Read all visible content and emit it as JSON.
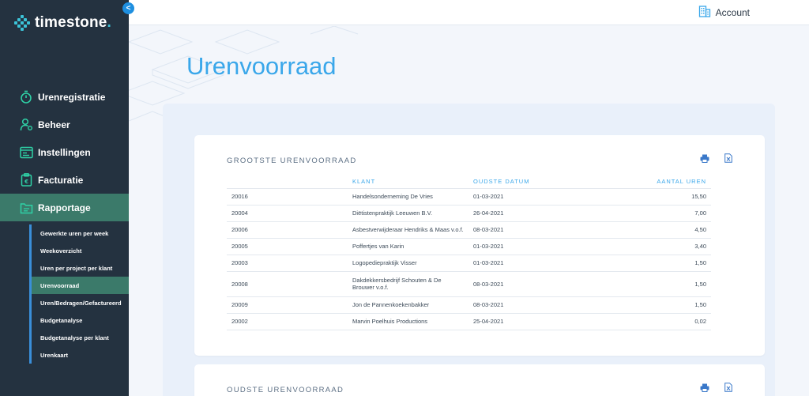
{
  "app": {
    "logo_text": "timestone",
    "logo_dot": ".",
    "collapse_label": "<"
  },
  "topbar": {
    "account_label": "Account"
  },
  "nav": {
    "items": [
      {
        "label": "Urenregistratie",
        "icon": "stopwatch-icon"
      },
      {
        "label": "Beheer",
        "icon": "user-gear-icon"
      },
      {
        "label": "Instellingen",
        "icon": "settings-window-icon"
      },
      {
        "label": "Facturatie",
        "icon": "invoice-clipboard-icon"
      },
      {
        "label": "Rapportage",
        "icon": "report-folder-icon"
      }
    ],
    "active": "Rapportage",
    "subitems": [
      "Gewerkte uren per week",
      "Weekoverzicht",
      "Uren per project per klant",
      "Urenvoorraad",
      "Uren/Bedragen/Gefactureerd",
      "Budgetanalyse",
      "Budgetanalyse per klant",
      "Urenkaart"
    ],
    "active_sub": "Urenvoorraad"
  },
  "page": {
    "title": "Urenvoorraad"
  },
  "card1": {
    "title": "GROOTSTE URENVOORRAAD",
    "columns": [
      "",
      "KLANT",
      "OUDSTE DATUM",
      "AANTAL UREN"
    ],
    "rows": [
      [
        "20016",
        "Handelsonderneming De Vries",
        "01-03-2021",
        "15,50"
      ],
      [
        "20004",
        "Diëtistenpraktijk Leeuwen B.V.",
        "26-04-2021",
        "7,00"
      ],
      [
        "20006",
        "Asbestverwijderaar Hendriks & Maas v.o.f.",
        "08-03-2021",
        "4,50"
      ],
      [
        "20005",
        "Poffertjes van Karin",
        "01-03-2021",
        "3,40"
      ],
      [
        "20003",
        "Logopediepraktijk Visser",
        "01-03-2021",
        "1,50"
      ],
      [
        "20008",
        "Dakdekkersbedrijf Schouten & De Brouwer v.o.f.",
        "08-03-2021",
        "1,50"
      ],
      [
        "20009",
        "Jon de Pannenkoekenbakker",
        "08-03-2021",
        "1,50"
      ],
      [
        "20002",
        "Marvin Poelhuis Productions",
        "25-04-2021",
        "0,02"
      ]
    ]
  },
  "card2": {
    "title": "OUDSTE URENVOORRAAD"
  },
  "colors": {
    "sidebar_bg": "#243240",
    "active_bg": "#3b7a6a",
    "accent_blue": "#3aa7ea",
    "logo_accent": "#3cc3d8",
    "icon_green": "#2fd1a6"
  }
}
